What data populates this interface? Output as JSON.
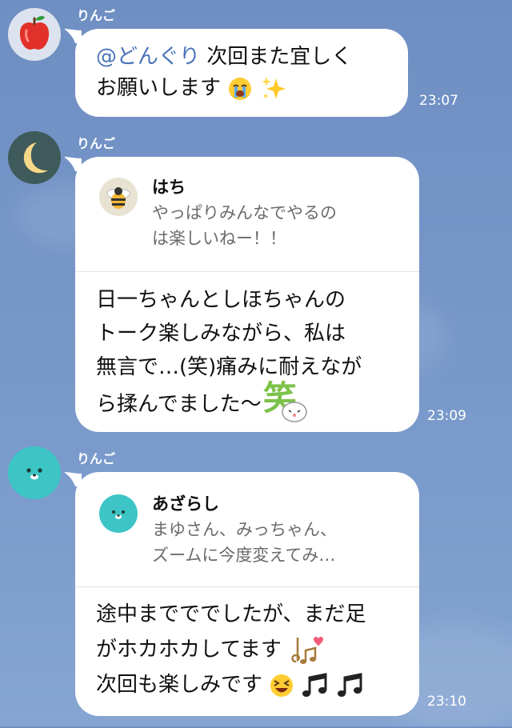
{
  "colors": {
    "background": "#7696c8",
    "bubble": "#ffffff",
    "mention": "#4a73b8",
    "quote_text": "#6b6b6b",
    "time_text": "#ffffff"
  },
  "messages": [
    {
      "sender": "りんご",
      "avatar_icon": "apple-icon",
      "mention": "@どんぐり",
      "lines": [
        " 次回また宜しく",
        "お願いします"
      ],
      "emoji": [
        "crying-face-icon",
        "sparkles-icon"
      ],
      "time": "23:07"
    },
    {
      "sender": "りんご",
      "avatar_icon": "moon-icon",
      "quote": {
        "name": "はち",
        "avatar_icon": "bee-icon",
        "lines": [
          "やっぱりみんなでやるの",
          "は楽しいねー！！"
        ]
      },
      "lines": [
        "日一ちゃんとしほちゃんの",
        "トーク楽しみながら、私は",
        "無言で…(笑)痛みに耐えなが",
        "ら揉んでました〜"
      ],
      "sticker_text": "笑",
      "time": "23:09"
    },
    {
      "sender": "りんご",
      "avatar_icon": "seal-icon",
      "quote": {
        "name": "あざらし",
        "avatar_icon": "seal-icon",
        "lines": [
          "まゆさん、みっちゃん、",
          "ズームに今度変えてみ…"
        ]
      },
      "lines": [
        "途中までででしたが、まだ足",
        "がホカホカしてます",
        "次回も楽しみです"
      ],
      "emoji": [
        "music-heart-icon",
        "grinning-squint-icon",
        "music-notes-icon",
        "music-notes-icon"
      ],
      "time": "23:10"
    }
  ]
}
